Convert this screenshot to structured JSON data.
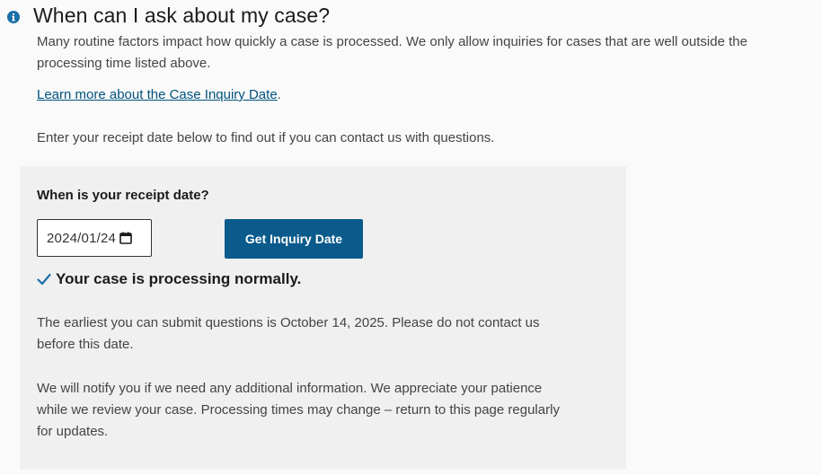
{
  "section": {
    "title": "When can I ask about my case?",
    "intro": "Many routine factors impact how quickly a case is processed. We only allow inquiries for cases that are well outside the processing time listed above.",
    "learn_link": "Learn more about the Case Inquiry Date",
    "learn_link_suffix": ".",
    "enter_text": "Enter your receipt date below to find out if you can contact us with questions."
  },
  "form": {
    "label": "When is your receipt date?",
    "date_value": "2024/01/24",
    "button_label": "Get Inquiry Date"
  },
  "result": {
    "status": "Your case is processing normally.",
    "earliest": "The earliest you can submit questions is October 14, 2025. Please do not contact us before this date.",
    "notify": "We will notify you if we need any additional information. We appreciate your patience while we review your case. Processing times may change – return to this page regularly for updates."
  },
  "icons": {
    "info": "info-icon",
    "calendar": "calendar-icon",
    "check": "check-icon"
  },
  "colors": {
    "accent": "#0a5a8c",
    "link": "#00527c",
    "info_icon": "#1a6fa8",
    "check": "#1a6fa8",
    "panel_bg": "#f0f0f0"
  }
}
